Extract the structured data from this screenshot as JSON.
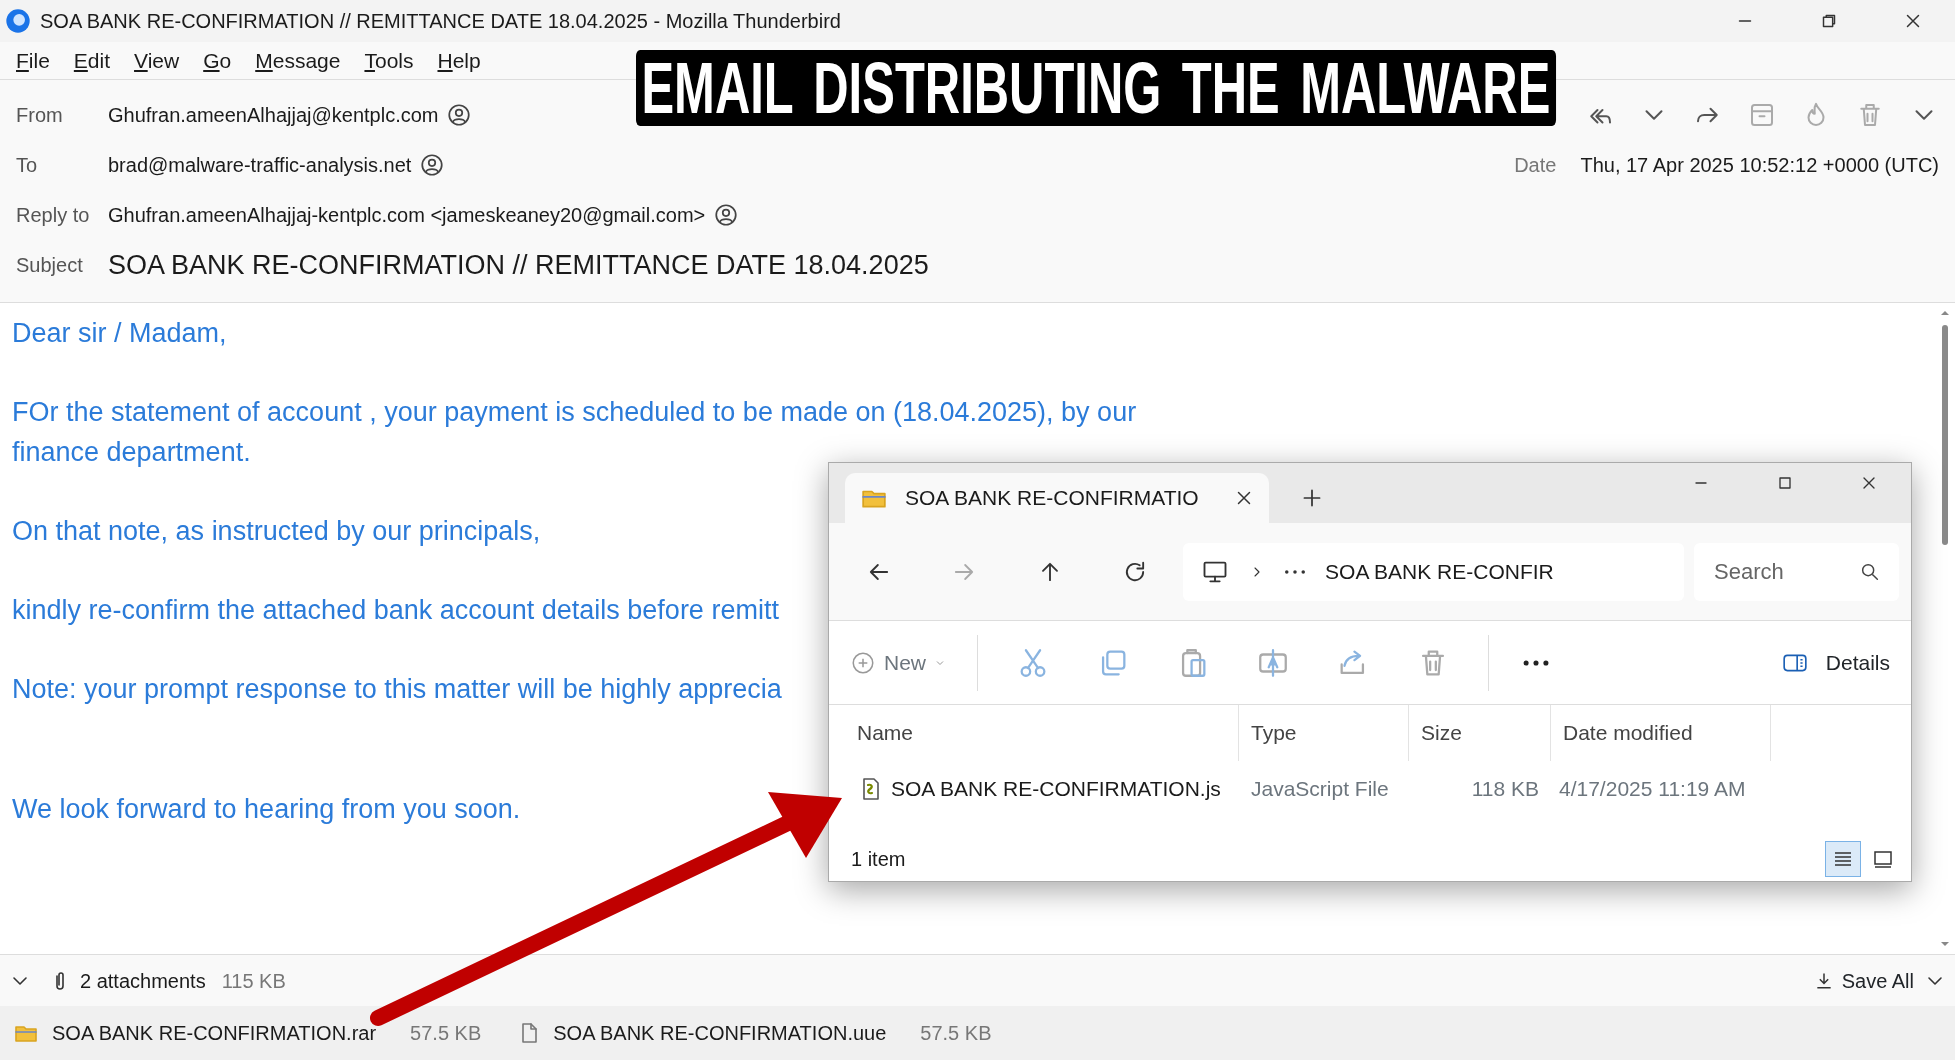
{
  "window": {
    "title": "SOA BANK RE-CONFIRMATION // REMITTANCE DATE 18.04.2025 - Mozilla Thunderbird"
  },
  "menu": [
    "File",
    "Edit",
    "View",
    "Go",
    "Message",
    "Tools",
    "Help"
  ],
  "caption": "EMAIL DISTRIBUTING THE MALWARE",
  "header": {
    "fields": [
      {
        "label": "From",
        "value": "Ghufran.ameenAlhajjaj@kentplc.com"
      },
      {
        "label": "To",
        "value": "brad@malware-traffic-analysis.net"
      },
      {
        "label": "Reply to",
        "value": "Ghufran.ameenAlhajjaj-kentplc.com <jameskeaney20@gmail.com>"
      }
    ],
    "date": {
      "label": "Date",
      "value": "Thu, 17 Apr 2025 10:52:12 +0000 (UTC)"
    },
    "subject": {
      "label": "Subject",
      "value": "SOA BANK RE-CONFIRMATION // REMITTANCE DATE 18.04.2025"
    }
  },
  "body": {
    "paragraphs": [
      "Dear sir / Madam,",
      "FOr the statement of account , your payment is scheduled to be made on (18.04.2025), by our finance department.",
      "On that note, as instructed by our principals,",
      "kindly re-confirm the attached bank account details before remitt",
      "Note: your prompt response to this matter will be highly apprecia",
      "We look forward to hearing from you soon."
    ]
  },
  "attachments": {
    "summary": "2 attachments",
    "size": "115 KB",
    "save_all": "Save All",
    "files": [
      {
        "name": "SOA BANK RE-CONFIRMATION.rar",
        "size": "57.5 KB",
        "kind": "archive"
      },
      {
        "name": "SOA BANK RE-CONFIRMATION.uue",
        "size": "57.5 KB",
        "kind": "file"
      }
    ]
  },
  "explorer": {
    "tab_title": "SOA BANK RE-CONFIRMATIO",
    "address": "SOA BANK RE-CONFIR",
    "search": {
      "placeholder": "Search"
    },
    "new_label": "New",
    "details_label": "Details",
    "columns": [
      "Name",
      "Type",
      "Size",
      "Date modified"
    ],
    "rows": [
      {
        "name": "SOA BANK RE-CONFIRMATION.js",
        "type": "JavaScript File",
        "size": "118 KB",
        "date": "4/17/2025 11:19 AM"
      }
    ],
    "status": "1 item",
    "views": [
      {
        "kind": "details",
        "selected": true
      },
      {
        "kind": "tiles",
        "selected": false
      }
    ]
  }
}
